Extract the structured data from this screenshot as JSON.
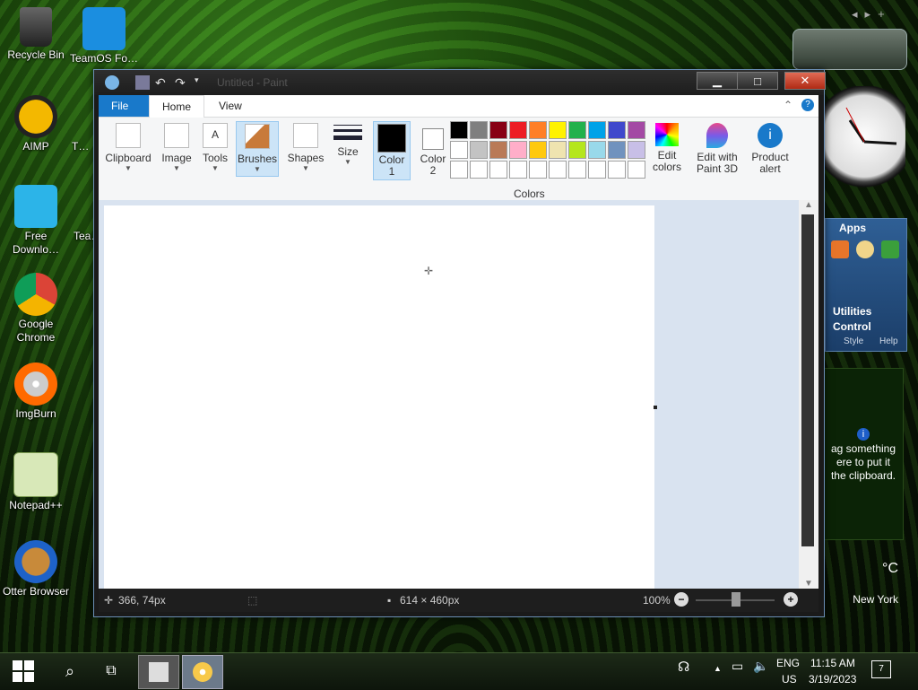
{
  "desktop": {
    "icons": [
      {
        "label": "Recycle Bin"
      },
      {
        "label": "TeamOS Fo…"
      },
      {
        "label": "AIMP"
      },
      {
        "label": "T…"
      },
      {
        "label": "Free Downlo…"
      },
      {
        "label": "Tea…"
      },
      {
        "label": "Google Chrome"
      },
      {
        "label": "ImgBurn"
      },
      {
        "label": "Notepad++"
      },
      {
        "label": "Otter Browser"
      }
    ]
  },
  "window": {
    "title": "Untitled - Paint",
    "tabs": {
      "file": "File",
      "home": "Home",
      "view": "View"
    },
    "ribbon": {
      "clipboard": "Clipboard",
      "image": "Image",
      "tools": "Tools",
      "brushes": "Brushes",
      "shapes": "Shapes",
      "size": "Size",
      "color1": "Color 1",
      "color2": "Color 2",
      "colors_group": "Colors",
      "edit_colors": "Edit colors",
      "edit_paint3d": "Edit with Paint 3D",
      "product_alert": "Product alert"
    },
    "palette_row1": [
      "#000000",
      "#7f7f7f",
      "#880015",
      "#ed1c24",
      "#ff7f27",
      "#fff200",
      "#22b14c",
      "#00a2e8",
      "#3f48cc",
      "#a349a4"
    ],
    "palette_row2": [
      "#ffffff",
      "#c3c3c3",
      "#b97a57",
      "#ffaec9",
      "#ffc90e",
      "#efe4b0",
      "#b5e61d",
      "#99d9ea",
      "#7092be",
      "#c8bfe7"
    ],
    "status": {
      "cursor_pos": "366, 74px",
      "canvas_size": "614 × 460px",
      "zoom": "100%"
    }
  },
  "gadgets": {
    "apps_title": "Apps",
    "utilities": "Utilities",
    "control": "Control",
    "style": "Style",
    "help": "Help",
    "clipboard_hint": "ag something ere to put it the clipboard.",
    "weather_temp": "°C",
    "weather_city": "New York"
  },
  "taskbar": {
    "lang": "ENG",
    "region": "US",
    "time": "11:15 AM",
    "date": "3/19/2023",
    "notif_count": "7"
  }
}
